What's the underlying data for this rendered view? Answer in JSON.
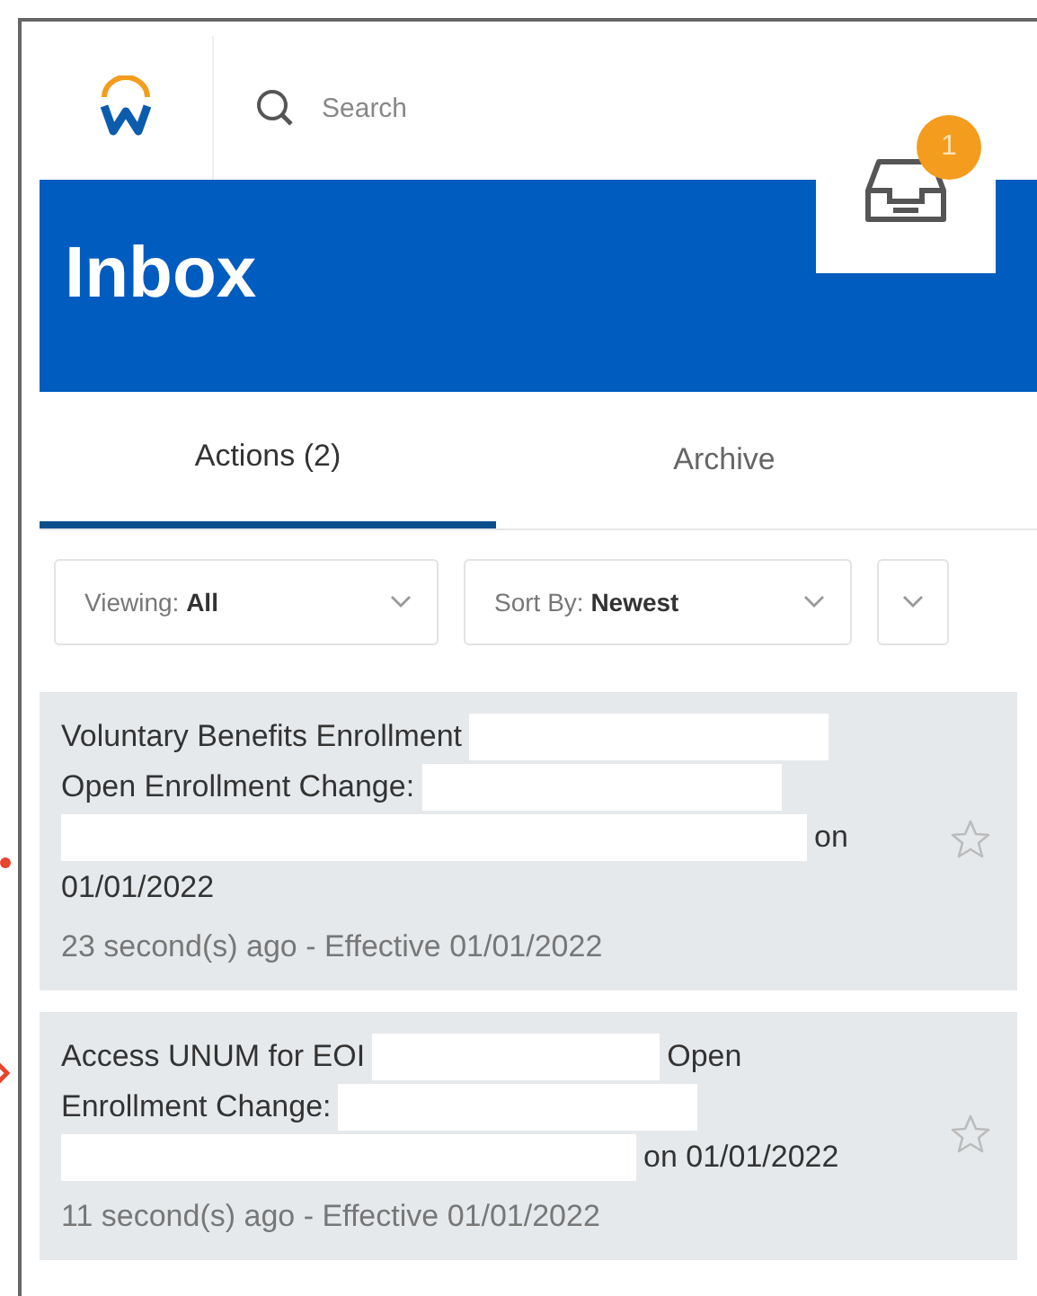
{
  "header": {
    "search": {
      "placeholder": "Search"
    },
    "inbox_badge": "1"
  },
  "banner": {
    "title": "Inbox"
  },
  "tabs": [
    {
      "label": "Actions (2)",
      "selected": true
    },
    {
      "label": "Archive",
      "selected": false
    }
  ],
  "filters": [
    {
      "label": "Viewing:",
      "value": "All"
    },
    {
      "label": "Sort By:",
      "value": "Newest"
    }
  ],
  "items": [
    {
      "title_parts": [
        {
          "kind": "text",
          "text": "Voluntary Benefits Enrollment"
        },
        {
          "kind": "redaction_medium"
        },
        {
          "kind": "text",
          "text": "Open Enrollment Change:"
        },
        {
          "kind": "redaction_medium"
        },
        {
          "kind": "redaction_line"
        },
        {
          "kind": "text",
          "text": "on"
        },
        {
          "kind": "text",
          "text": "01/01/2022"
        }
      ],
      "meta": "23 second(s) ago - Effective 01/01/2022",
      "starred": false,
      "marker": {
        "kind": "dot"
      }
    },
    {
      "title_parts": [
        {
          "kind": "text",
          "text": "Access UNUM for EOI"
        },
        {
          "kind": "redaction_short"
        },
        {
          "kind": "text",
          "text": "Open"
        },
        {
          "kind": "text",
          "text": "Enrollment Change:"
        },
        {
          "kind": "redaction_medium"
        },
        {
          "kind": "redaction_long"
        },
        {
          "kind": "text",
          "text": "on 01/01/2022"
        }
      ],
      "meta": "11 second(s) ago - Effective 01/01/2022",
      "starred": false,
      "marker": {
        "kind": "arrow"
      }
    }
  ]
}
